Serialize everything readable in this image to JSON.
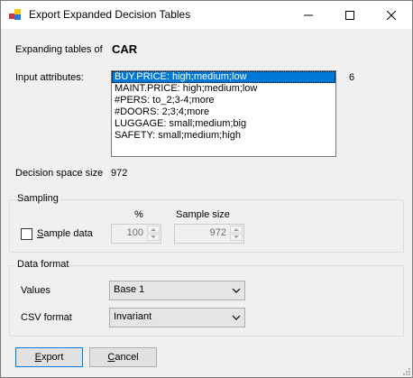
{
  "window": {
    "title": "Export Expanded Decision Tables"
  },
  "expanding": {
    "label": "Expanding tables of",
    "value": "CAR"
  },
  "input_attributes": {
    "label": "Input attributes:",
    "count": "6",
    "items": [
      "BUY.PRICE: high;medium;low",
      "MAINT.PRICE: high;medium;low",
      "#PERS: to_2;3-4;more",
      "#DOORS: 2;3;4;more",
      "LUGGAGE: small;medium;big",
      "SAFETY: small;medium;high"
    ],
    "selected_index": 0
  },
  "decision_space": {
    "label": "Decision space size",
    "value": "972"
  },
  "sampling": {
    "group_label": "Sampling",
    "checkbox_label": "Sample data",
    "checked": false,
    "percent_header": "%",
    "sample_size_header": "Sample size",
    "percent_value": "100",
    "sample_size_value": "972"
  },
  "data_format": {
    "group_label": "Data format",
    "values_label": "Values",
    "values_selected": "Base 1",
    "csv_label": "CSV format",
    "csv_selected": "Invariant"
  },
  "buttons": {
    "export": "Export",
    "cancel": "Cancel"
  },
  "colors": {
    "selection": "#0078d7",
    "dialog_bg": "#f0f0f0"
  }
}
